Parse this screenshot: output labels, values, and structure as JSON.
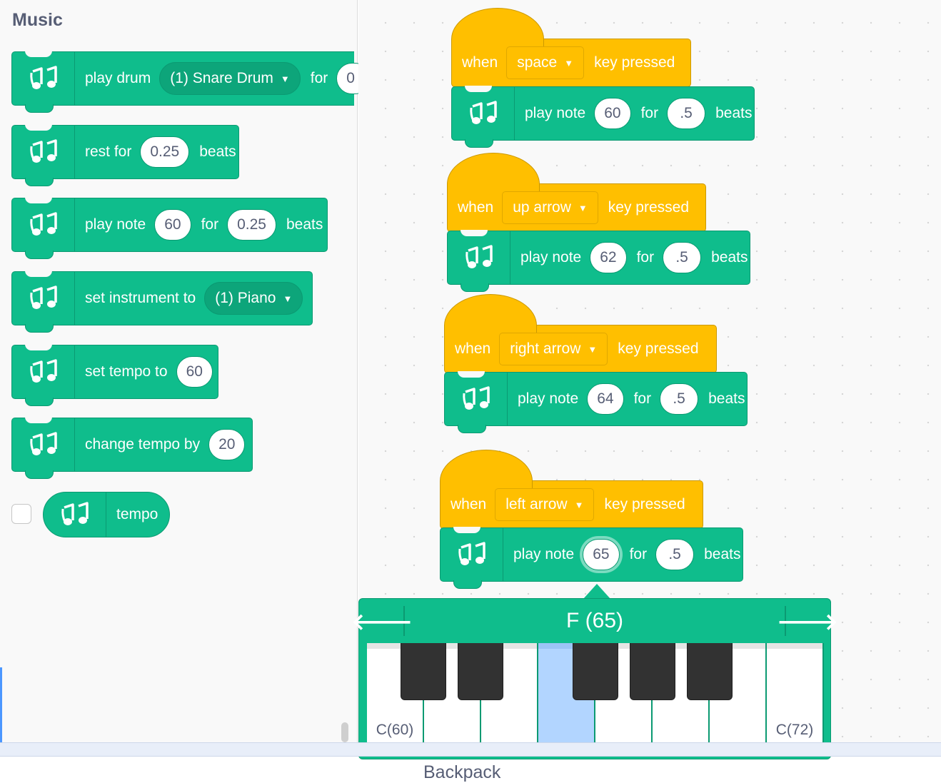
{
  "palette": {
    "category_title": "Music",
    "blocks": {
      "play_drum": {
        "label": "play drum",
        "drum": "(1) Snare Drum",
        "for": "for",
        "value": "0"
      },
      "rest": {
        "label": "rest for",
        "value": "0.25",
        "unit": "beats"
      },
      "play_note": {
        "label": "play note",
        "note": "60",
        "for": "for",
        "beats": "0.25",
        "unit": "beats"
      },
      "set_instrument": {
        "label": "set instrument to",
        "instrument": "(1) Piano"
      },
      "set_tempo": {
        "label": "set tempo to",
        "value": "60"
      },
      "change_tempo": {
        "label": "change tempo by",
        "value": "20"
      },
      "tempo_reporter": {
        "label": "tempo"
      }
    }
  },
  "scripts": [
    {
      "when": "when",
      "key": "space",
      "pressed": "key pressed",
      "play": "play note",
      "note": "60",
      "for": "for",
      "beats": ".5",
      "unit": "beats"
    },
    {
      "when": "when",
      "key": "up arrow",
      "pressed": "key pressed",
      "play": "play note",
      "note": "62",
      "for": "for",
      "beats": ".5",
      "unit": "beats"
    },
    {
      "when": "when",
      "key": "right arrow",
      "pressed": "key pressed",
      "play": "play note",
      "note": "64",
      "for": "for",
      "beats": ".5",
      "unit": "beats"
    },
    {
      "when": "when",
      "key": "left arrow",
      "pressed": "key pressed",
      "play": "play note",
      "note": "65",
      "for": "for",
      "beats": ".5",
      "unit": "beats"
    }
  ],
  "piano": {
    "note_label": "F (65)",
    "low_label": "C(60)",
    "high_label": "C(72)",
    "selected_note": 65
  },
  "footer": {
    "backpack_label": "Backpack"
  },
  "colors": {
    "sound_block": "#0fbd8c",
    "event_block": "#ffbf00",
    "text_gray": "#575e75",
    "selected_key": "#b2d5ff"
  },
  "icons": {
    "block_icon": "music-notes-icon",
    "dropdown": "caret-down-icon",
    "piano_prev": "arrow-left-icon",
    "piano_next": "arrow-right-icon"
  }
}
